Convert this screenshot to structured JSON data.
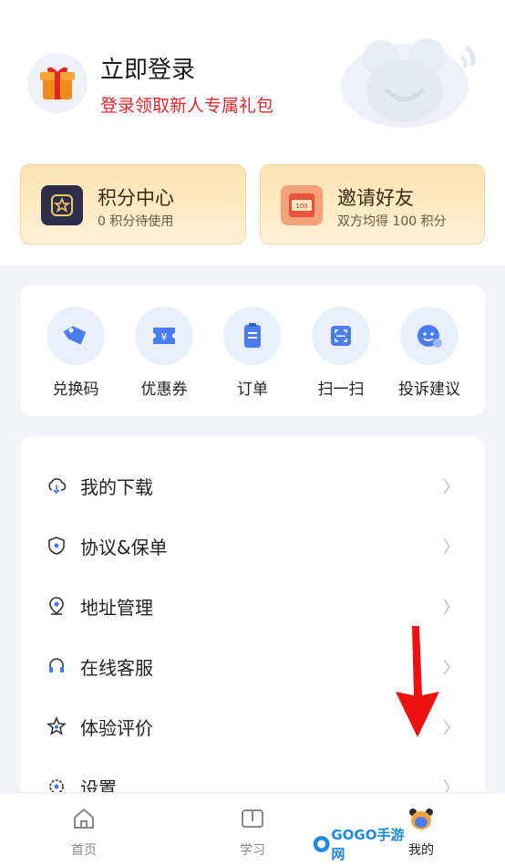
{
  "header": {
    "login_title": "立即登录",
    "login_subtitle": "登录领取新人专属礼包"
  },
  "cards": {
    "points": {
      "title": "积分中心",
      "subtitle": "0 积分待使用"
    },
    "invite": {
      "title": "邀请好友",
      "subtitle": "双方均得 100 积分",
      "ticket_value": "100"
    }
  },
  "quick_actions": [
    {
      "label": "兑换码",
      "icon": "tag-icon"
    },
    {
      "label": "优惠券",
      "icon": "coupon-icon"
    },
    {
      "label": "订单",
      "icon": "order-icon"
    },
    {
      "label": "扫一扫",
      "icon": "scan-icon"
    },
    {
      "label": "投诉建议",
      "icon": "feedback-icon"
    }
  ],
  "menu": [
    {
      "label": "我的下载",
      "icon": "cloud-download-icon"
    },
    {
      "label": "协议&保单",
      "icon": "shield-icon"
    },
    {
      "label": "地址管理",
      "icon": "location-icon"
    },
    {
      "label": "在线客服",
      "icon": "headset-icon"
    },
    {
      "label": "体验评价",
      "icon": "star-icon"
    },
    {
      "label": "设置",
      "icon": "gear-icon"
    }
  ],
  "chevron": "〉",
  "tabs": [
    {
      "label": "首页",
      "icon": "home-icon"
    },
    {
      "label": "学习",
      "icon": "book-icon"
    },
    {
      "label": "我的",
      "icon": "profile-icon",
      "active": true
    }
  ],
  "watermark": {
    "text": "GOGO手游网"
  },
  "colors": {
    "accent_red": "#e0262b",
    "card_gold": "#fde3b0",
    "icon_blue": "#4b7df0",
    "arrow_red": "#ee1111"
  }
}
